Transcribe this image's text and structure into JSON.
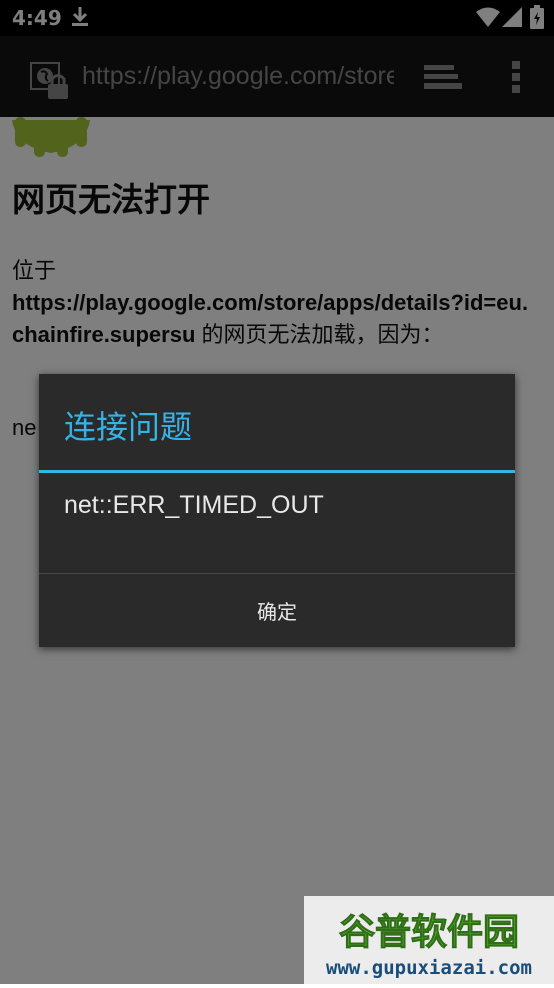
{
  "status_bar": {
    "time": "4:49",
    "icons": [
      "download-icon",
      "wifi-icon",
      "signal-icon",
      "battery-icon"
    ]
  },
  "toolbar": {
    "url": "https://play.google.com/store/apps/details?id=eu.chainfire.supersu",
    "icons": [
      "site-lock-icon",
      "tabs-icon",
      "overflow-menu-icon"
    ]
  },
  "page": {
    "title": "网页无法打开",
    "intro": "位于",
    "url": "https://play.google.com/store/apps/details?id=eu.chainfire.supersu",
    "reason": " 的网页无法加载，因为：",
    "error_snippet": "ne"
  },
  "dialog": {
    "title": "连接问题",
    "message": "net::ERR_TIMED_OUT",
    "ok_label": "确定"
  },
  "watermark": {
    "logo_text": "谷普软件园",
    "site": "www.gupuxiazai.com"
  },
  "colors": {
    "accent": "#33b5e5",
    "dialog_bg": "#2a2a2a",
    "toolbar_bg": "#141414",
    "watermark_green": "#5ab52e"
  }
}
